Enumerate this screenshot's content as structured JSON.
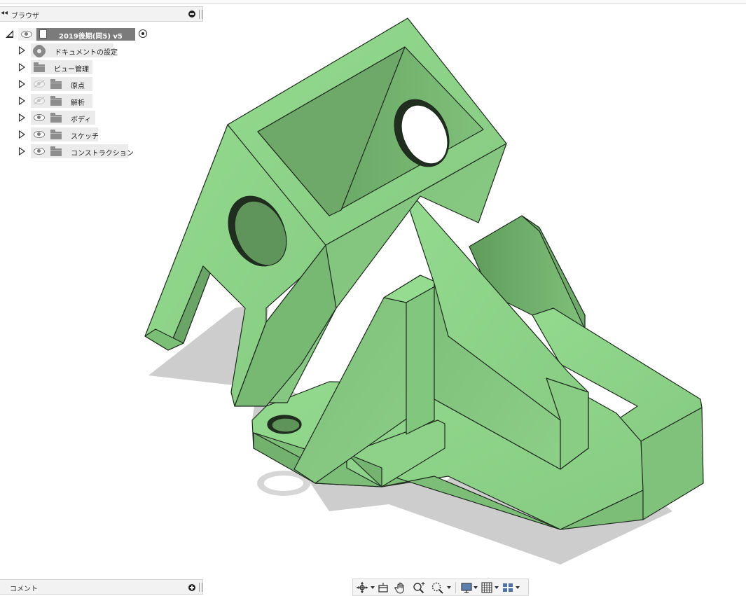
{
  "browser": {
    "title": "ブラウザ",
    "root": {
      "label": "2019後期(同5) v5"
    },
    "items": [
      {
        "label": "ドキュメントの設定",
        "icon": "gear-icon",
        "eye": "none"
      },
      {
        "label": "ビュー管理",
        "icon": "folder-icon",
        "eye": "none"
      },
      {
        "label": "原点",
        "icon": "folder-icon",
        "eye": "hidden"
      },
      {
        "label": "解析",
        "icon": "folder-icon",
        "eye": "hidden"
      },
      {
        "label": "ボディ",
        "icon": "folder-icon",
        "eye": "visible"
      },
      {
        "label": "スケッチ",
        "icon": "folder-icon",
        "eye": "visible"
      },
      {
        "label": "コンストラクション",
        "icon": "folder-icon",
        "eye": "visible"
      }
    ]
  },
  "comments": {
    "title": "コメント"
  },
  "toolbar": {
    "tools": [
      "orbit-icon",
      "look-at-icon",
      "pan-icon",
      "zoom-icon",
      "fit-icon",
      "display-settings-icon",
      "grid-settings-icon",
      "viewports-icon"
    ]
  },
  "colors": {
    "model_face_light": "#8fd68a",
    "model_face_mid": "#86c982",
    "model_face_dark": "#6fae6b",
    "shadow": "#cfcfcf",
    "edge": "#1e2a1e"
  }
}
